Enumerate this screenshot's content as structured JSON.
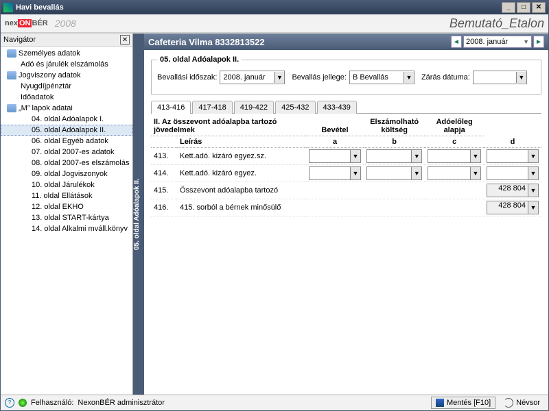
{
  "window": {
    "title": "Havi bevallás"
  },
  "brand": {
    "nex": "nex",
    "on": "ON",
    "ber": "BÉR",
    "year": "2008",
    "db": "Bemutató_Etalon"
  },
  "nav": {
    "title": "Navigátor",
    "items": [
      {
        "level": "root",
        "icon": true,
        "label": "Személyes adatok"
      },
      {
        "level": "lvl1",
        "label": "Adó és járulék elszámolás"
      },
      {
        "level": "root",
        "icon": true,
        "label": "Jogviszony adatok"
      },
      {
        "level": "lvl1",
        "label": "Nyugdíjpénztár"
      },
      {
        "level": "lvl1",
        "label": "Időadatok"
      },
      {
        "level": "root",
        "icon": true,
        "label": "„M” lapok adatai"
      },
      {
        "level": "lvl2",
        "label": "04. oldal Adóalapok I."
      },
      {
        "level": "lvl2",
        "label": "05. oldal Adóalapok II.",
        "selected": true
      },
      {
        "level": "lvl2",
        "label": "06. oldal Egyéb adatok"
      },
      {
        "level": "lvl2",
        "label": "07. oldal 2007-es adatok"
      },
      {
        "level": "lvl2",
        "label": "08. oldal 2007-es elszámolás"
      },
      {
        "level": "lvl2",
        "label": "09. oldal Jogviszonyok"
      },
      {
        "level": "lvl2",
        "label": "10. oldal Járulékok"
      },
      {
        "level": "lvl2",
        "label": "11. oldal Ellátások"
      },
      {
        "level": "lvl2",
        "label": "12. oldal EKHO"
      },
      {
        "level": "lvl2",
        "label": "13. oldal START-kártya"
      },
      {
        "level": "lvl2",
        "label": "14. oldal Alkalmi mváll.könyv"
      }
    ]
  },
  "sideTab": "05. oldal Adóalapok II.",
  "header": {
    "title": "Cafeteria Vilma 8332813522",
    "period": "2008. január"
  },
  "page": {
    "legend": "05. oldal Adóalapok II.",
    "fields": {
      "bevallasi_idoszak_label": "Bevallási időszak:",
      "bevallasi_idoszak": "2008. január",
      "bevallas_jellege_label": "Bevallás jellege:",
      "bevallas_jellege": "B Bevallás",
      "zaras_datuma_label": "Zárás dátuma:",
      "zaras_datuma": ""
    },
    "tabs": [
      "413-416",
      "417-418",
      "419-422",
      "425-432",
      "433-439"
    ],
    "activeTab": 0,
    "tableHeader": {
      "group": "II. Az összevont adóalapba tartozó jövedelmek",
      "col_a": "Bevétel",
      "col_b": "Elszámolható költség",
      "col_c": "Adóelőleg alapja",
      "sub_desc": "Leírás",
      "la": "a",
      "lb": "b",
      "lc": "c",
      "ld": "d"
    },
    "rows": [
      {
        "n": "413.",
        "desc": "Kett.adó. kizáró egyez.sz.",
        "a": "",
        "b": "",
        "c": "",
        "d": "",
        "editable": true
      },
      {
        "n": "414.",
        "desc": "Kett.adó. kizáró egyez.",
        "a": "",
        "b": "",
        "c": "",
        "d": "",
        "editable": true
      },
      {
        "n": "415.",
        "desc": "Összevont adóalapba tartozó",
        "d": "428 804",
        "readonly": true
      },
      {
        "n": "416.",
        "desc": "415. sorból a bérnek minősülő",
        "d": "428 804",
        "readonly": true
      }
    ]
  },
  "status": {
    "user_label": "Felhasználó: ",
    "user": "NexonBÉR adminisztrátor",
    "save": "Mentés [F10]",
    "nevsor": "Névsor"
  }
}
